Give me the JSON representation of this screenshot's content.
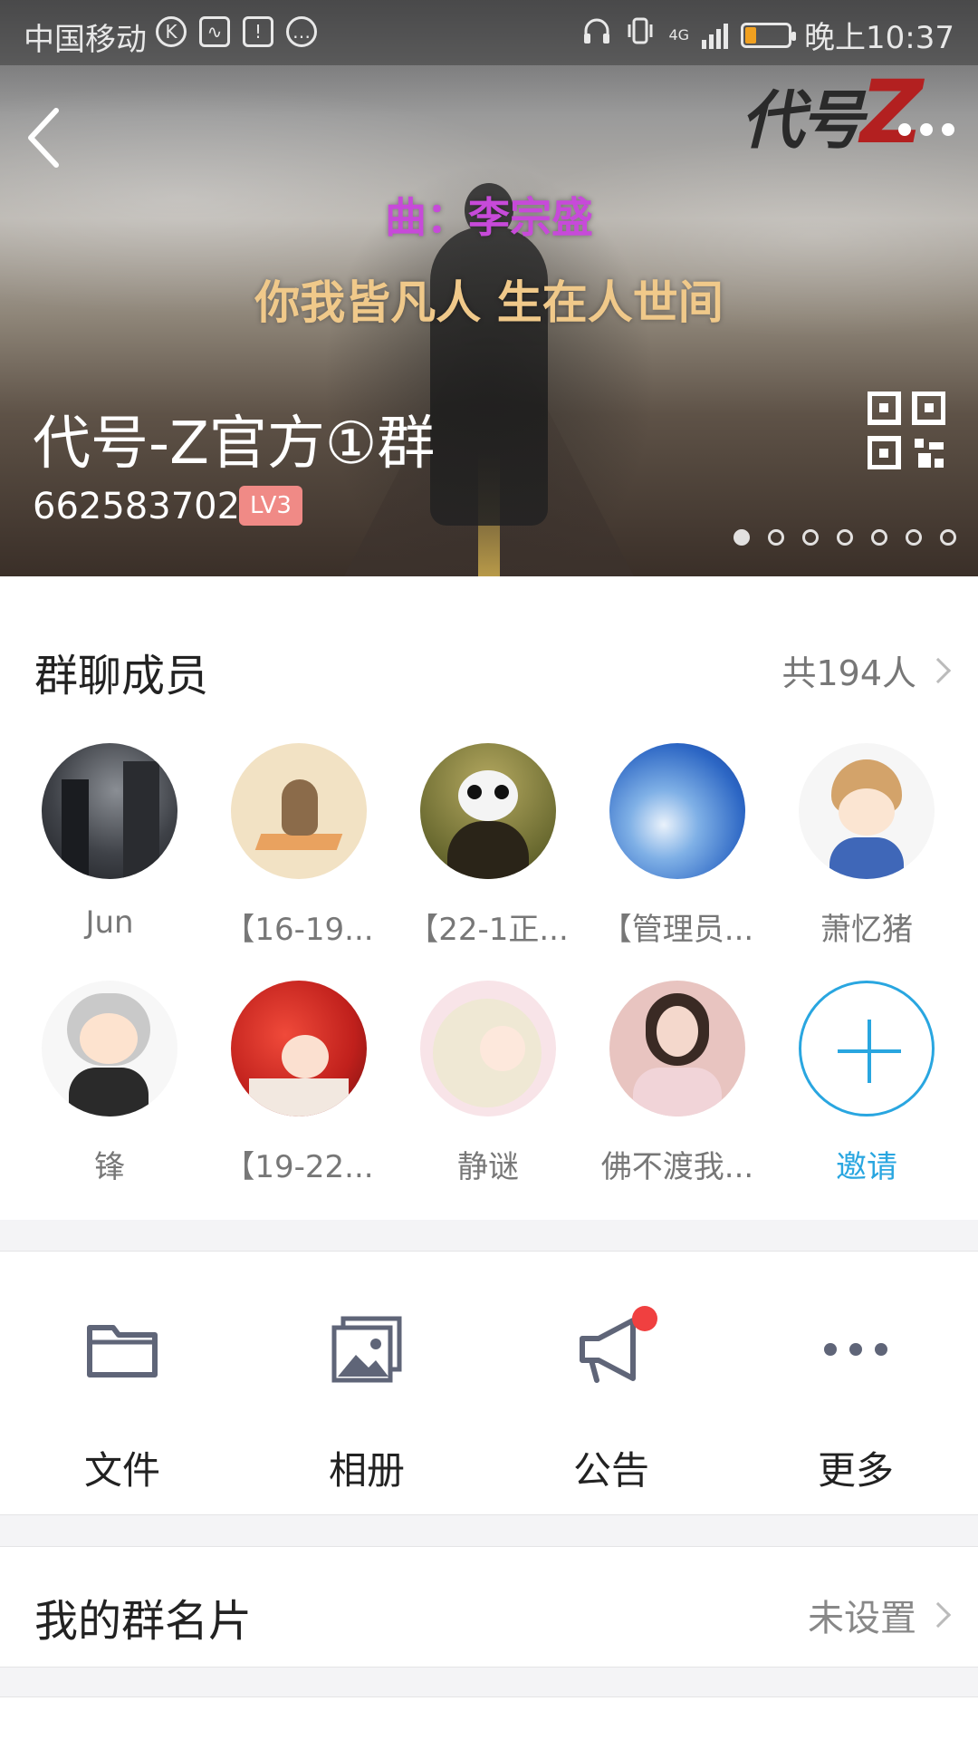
{
  "status_bar": {
    "carrier": "中国移动",
    "network": "4G",
    "time": "晚上10:37"
  },
  "hero": {
    "logo_text": "代号",
    "logo_z": "Z",
    "lyric_line1": "曲：李宗盛",
    "lyric_line2": "你我皆凡人 生在人世间",
    "group_name": "代号-Z官方①群",
    "group_id": "662583702",
    "level_badge": "LV3",
    "carousel_dots": 7,
    "carousel_active": 0
  },
  "members_section": {
    "title": "群聊成员",
    "count_text": "共194人",
    "members": [
      {
        "name": "Jun",
        "avatar": "dark-city-avatar"
      },
      {
        "name": "【16-19...",
        "avatar": "cat-meditating-avatar"
      },
      {
        "name": "【22-1正...",
        "avatar": "panda-mona-lisa-avatar"
      },
      {
        "name": "【管理员...",
        "avatar": "blue-sky-avatar"
      },
      {
        "name": "萧忆猪",
        "avatar": "anime-boy-avatar"
      },
      {
        "name": "锋",
        "avatar": "chibi-hood-avatar"
      },
      {
        "name": "【19-22...",
        "avatar": "red-hair-anime-avatar"
      },
      {
        "name": "静谜",
        "avatar": "white-hair-anime-avatar"
      },
      {
        "name": "佛不渡我...",
        "avatar": "girl-photo-avatar"
      }
    ],
    "invite_label": "邀请"
  },
  "tools": [
    {
      "label": "文件",
      "icon": "folder-icon"
    },
    {
      "label": "相册",
      "icon": "album-icon"
    },
    {
      "label": "公告",
      "icon": "megaphone-icon",
      "badge": true
    },
    {
      "label": "更多",
      "icon": "more-dots-icon"
    }
  ],
  "my_card": {
    "title": "我的群名片",
    "value": "未设置"
  },
  "colors": {
    "accent": "#29a6e0",
    "badge_red": "#f04040",
    "level_badge": "#f08a86",
    "icon_gray": "#5f6578",
    "lyric_purple": "#c74ad9",
    "lyric_gold": "#f0c98a"
  }
}
